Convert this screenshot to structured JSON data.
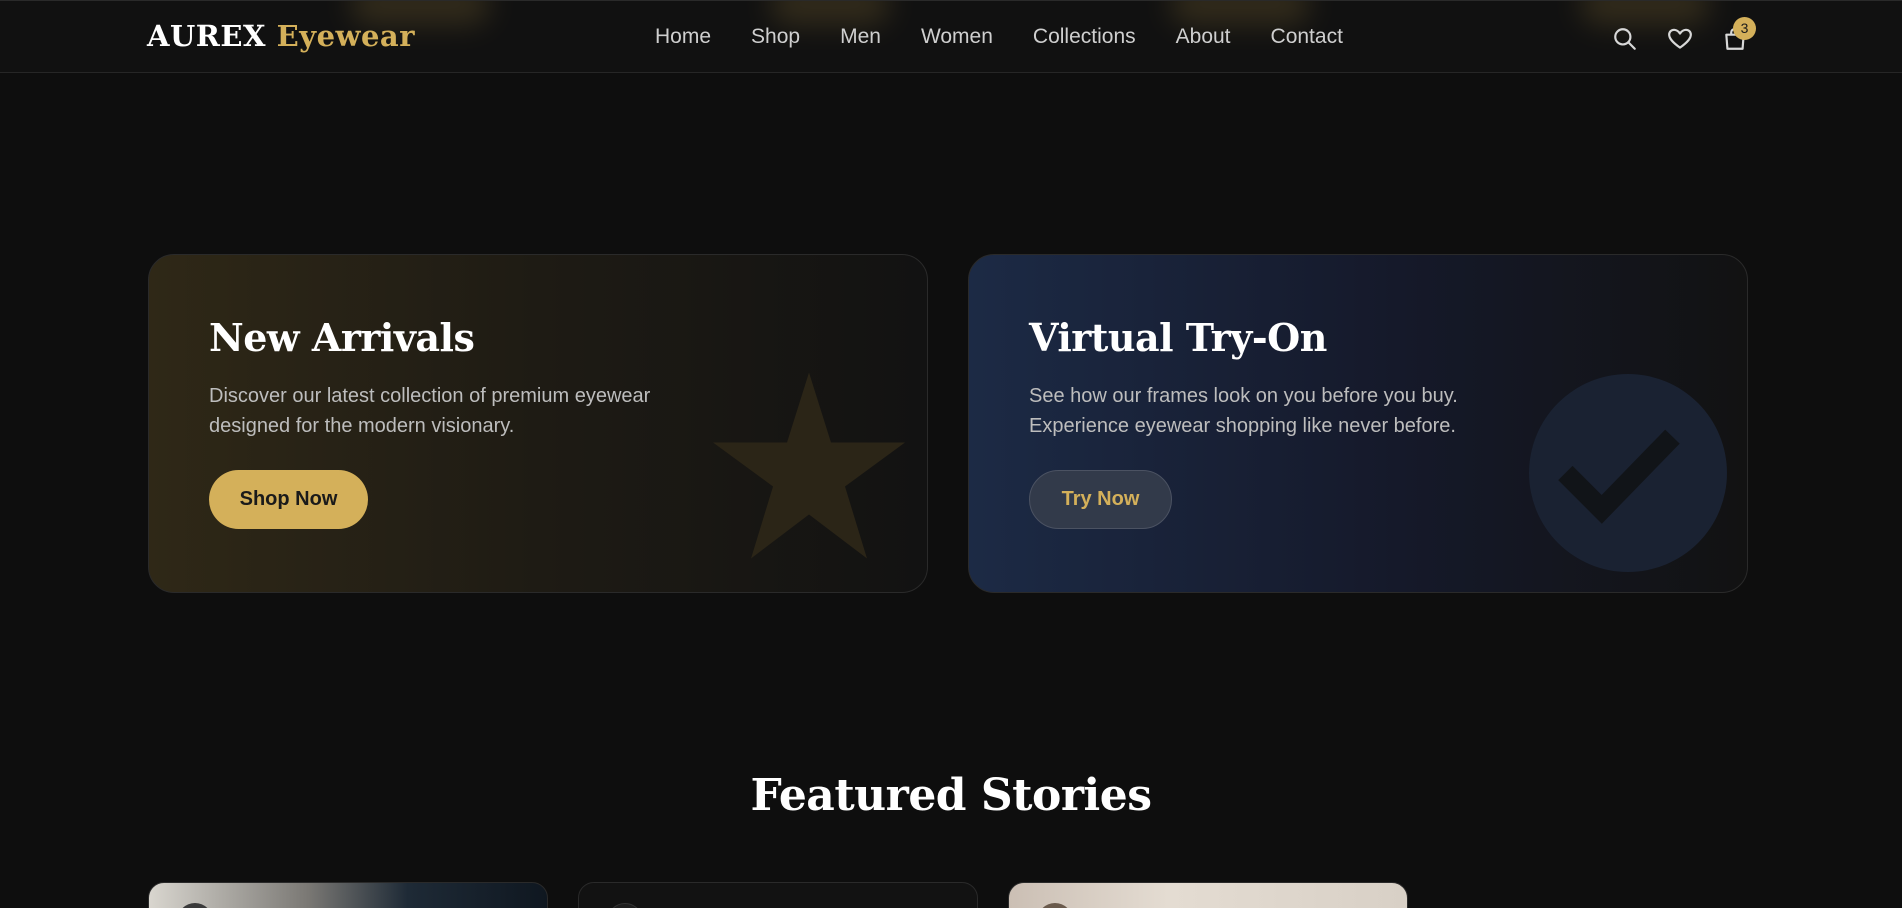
{
  "brand": {
    "name_main": "AUREX",
    "name_accent": "Eyewear",
    "accent_color": "#d4b05a"
  },
  "nav": {
    "items": [
      "Home",
      "Shop",
      "Men",
      "Women",
      "Collections",
      "About",
      "Contact"
    ]
  },
  "header_icons": {
    "search": "search-icon",
    "wishlist": "heart-icon",
    "cart": "shopping-bag-icon",
    "cart_count": "3"
  },
  "promo": [
    {
      "title": "New Arrivals",
      "description": "Discover our latest collection of premium eyewear designed for the modern visionary.",
      "button": "Shop Now",
      "icon": "star-icon"
    },
    {
      "title": "Virtual Try-On",
      "description": "See how our frames look on you before you buy. Experience eyewear shopping like never before.",
      "button": "Try Now",
      "icon": "check-circle-icon"
    }
  ],
  "featured": {
    "title": "Featured Stories"
  },
  "colors": {
    "background": "#0e0e0e",
    "gold": "#d4b05a",
    "blue_card": "#1c2a45"
  }
}
